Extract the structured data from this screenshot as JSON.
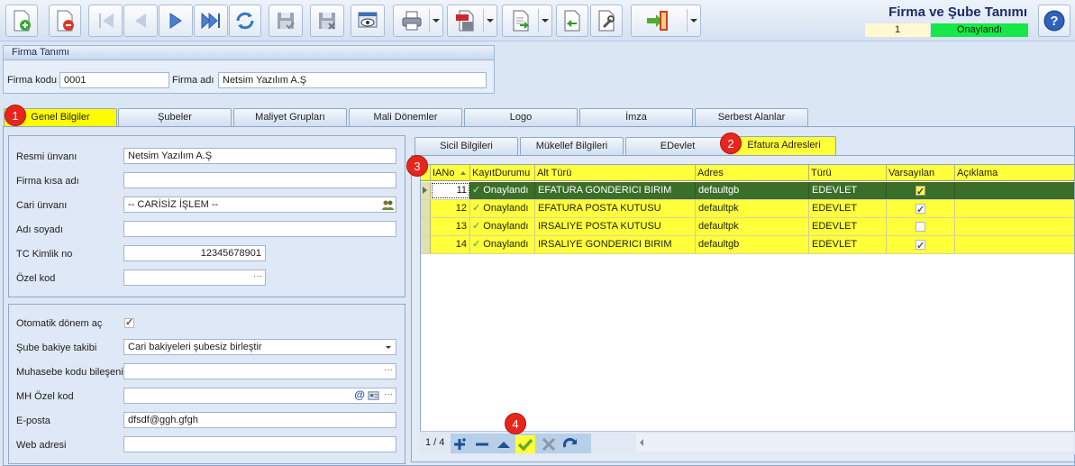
{
  "toolbar": {
    "form_title": "Firma ve Şube Tanımı",
    "record_no": "1",
    "status": "Onaylandı",
    "status_color": "#16e84a",
    "buttons": [
      "new-record",
      "delete-record",
      "first-record",
      "prev-record",
      "next-record",
      "last-record",
      "refresh",
      "save",
      "save-close",
      "preview",
      "print",
      "export-pdf",
      "export",
      "import",
      "tools",
      "exit",
      "help"
    ]
  },
  "firma": {
    "group_title": "Firma Tanımı",
    "kod_label": "Firma kodu",
    "kod_value": "0001",
    "adi_label": "Firma adı",
    "adi_value": "Netsim Yazılım A.Ş"
  },
  "main_tabs": [
    {
      "label": "Genel Bilgiler",
      "badge": "1"
    },
    {
      "label": "Şubeler"
    },
    {
      "label": "Maliyet Grupları"
    },
    {
      "label": "Mali Dönemler"
    },
    {
      "label": "Logo"
    },
    {
      "label": "İmza"
    },
    {
      "label": "Serbest Alanlar"
    }
  ],
  "general": {
    "resmi_unvan_label": "Resmi ünvanı",
    "resmi_unvan_value": "Netsim Yazılım A.Ş",
    "kisa_adi_label": "Firma kısa adı",
    "kisa_adi_value": "",
    "cari_unvan_label": "Cari ünvanı",
    "cari_unvan_value": "-- CARİSİZ İŞLEM --",
    "adi_soyadi_label": "Adı soyadı",
    "adi_soyadi_value": "",
    "tc_label": "TC Kimlik no",
    "tc_value": "12345678901",
    "ozel_kod_label": "Özel kod",
    "ozel_kod_value": "",
    "ellipsis": "···"
  },
  "settings": {
    "otomatik_label": "Otomatik dönem aç",
    "otomatik_checked": true,
    "sube_bakiye_label": "Şube bakiye takibi",
    "sube_bakiye_value": "Cari bakiyeleri şubesiz birleştir",
    "muhasebe_label": "Muhasebe kodu bileşeni",
    "muhasebe_value": "",
    "mh_ozel_label": "MH Özel kod",
    "mh_ozel_value": "",
    "eposta_label": "E-posta",
    "eposta_value": "dfsdf@ggh.gfgh",
    "web_label": "Web adresi",
    "web_value": ""
  },
  "sub_tabs": [
    {
      "label": "Sicil Bilgileri"
    },
    {
      "label": "Mükellef Bilgileri"
    },
    {
      "label": "EDevlet"
    },
    {
      "label": "Efatura Adresleri",
      "badge": "2"
    }
  ],
  "grid": {
    "badge": "3",
    "columns": [
      "IANo",
      "KayıtDurumu",
      "Alt Türü",
      "Adres",
      "Türü",
      "Varsayılan",
      "Açıklama"
    ],
    "rows": [
      {
        "iano": "11",
        "durum": "Onaylandı",
        "alt_turu": "EFATURA GONDERICI BIRIM",
        "adres": "defaultgb",
        "turu": "EDEVLET",
        "varsayilan": true,
        "aciklama": ""
      },
      {
        "iano": "12",
        "durum": "Onaylandı",
        "alt_turu": "EFATURA POSTA KUTUSU",
        "adres": "defaultpk",
        "turu": "EDEVLET",
        "varsayilan": true,
        "aciklama": ""
      },
      {
        "iano": "13",
        "durum": "Onaylandı",
        "alt_turu": "IRSALIYE POSTA KUTUSU",
        "adres": "defaultpk",
        "turu": "EDEVLET",
        "varsayilan": false,
        "aciklama": ""
      },
      {
        "iano": "14",
        "durum": "Onaylandı",
        "alt_turu": "IRSALIYE GONDERICI BIRIM",
        "adres": "defaultgb",
        "turu": "EDEVLET",
        "varsayilan": true,
        "aciklama": ""
      }
    ]
  },
  "navigator": {
    "page_info": "1 / 4",
    "badge": "4",
    "buttons": [
      "add",
      "remove",
      "up",
      "confirm",
      "cancel",
      "refresh"
    ]
  }
}
